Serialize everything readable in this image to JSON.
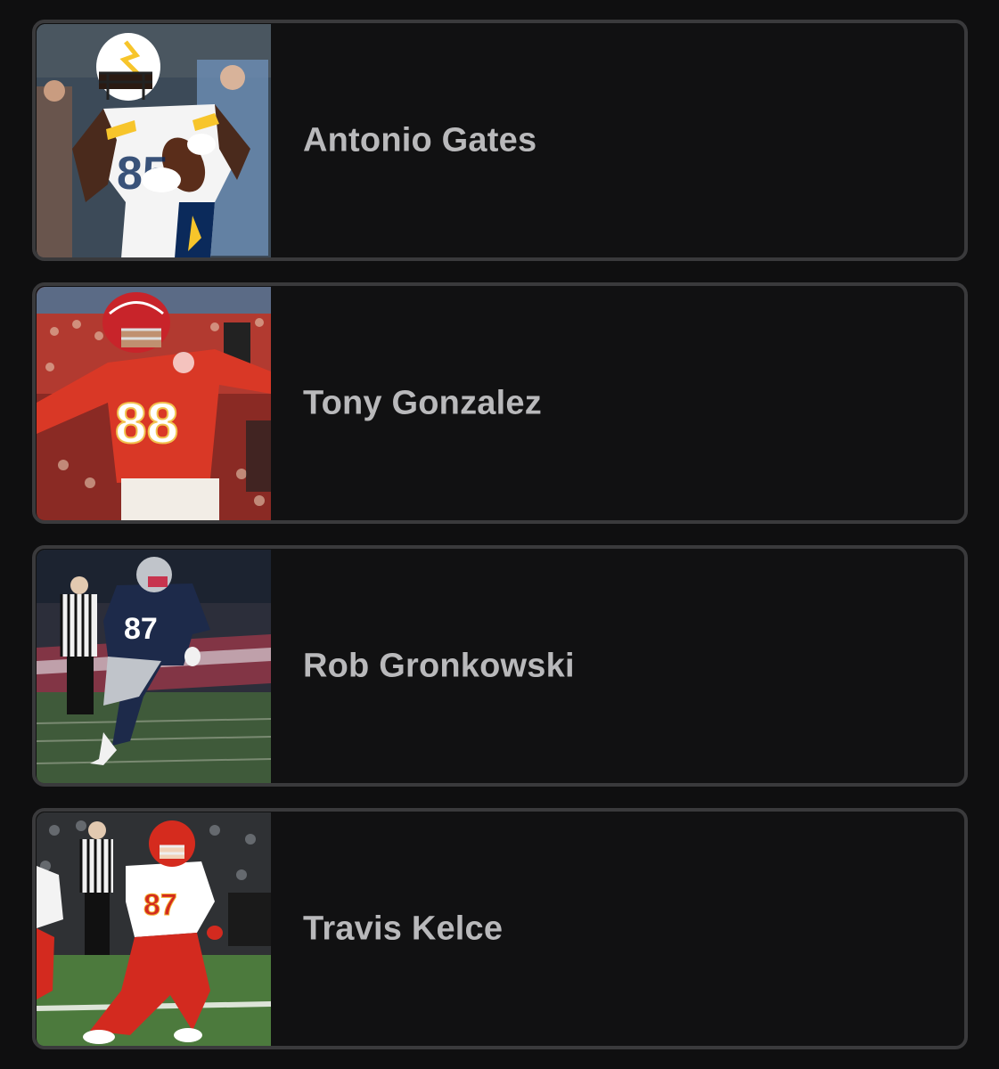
{
  "players": [
    {
      "name": "Antonio Gates",
      "photo_icon": "player-photo",
      "jersey_number": "85",
      "team_colors": {
        "jersey": "#f4f4f4",
        "trim": "#0b2a5b",
        "accent": "#f7c52b",
        "helmet": "#ffffff"
      }
    },
    {
      "name": "Tony Gonzalez",
      "photo_icon": "player-photo",
      "jersey_number": "88",
      "team_colors": {
        "jersey": "#d93826",
        "trim": "#ffffff",
        "accent": "#f2c14e",
        "helmet": "#c8242a"
      }
    },
    {
      "name": "Rob Gronkowski",
      "photo_icon": "player-photo",
      "jersey_number": "87",
      "team_colors": {
        "jersey": "#1d2a4a",
        "trim": "#ffffff",
        "accent": "#c8102e",
        "helmet": "#c0c4ca"
      }
    },
    {
      "name": "Travis Kelce",
      "photo_icon": "player-photo",
      "jersey_number": "87",
      "team_colors": {
        "jersey": "#ffffff",
        "trim": "#d32a1f",
        "accent": "#f2b233",
        "helmet": "#d52b1e"
      }
    }
  ]
}
